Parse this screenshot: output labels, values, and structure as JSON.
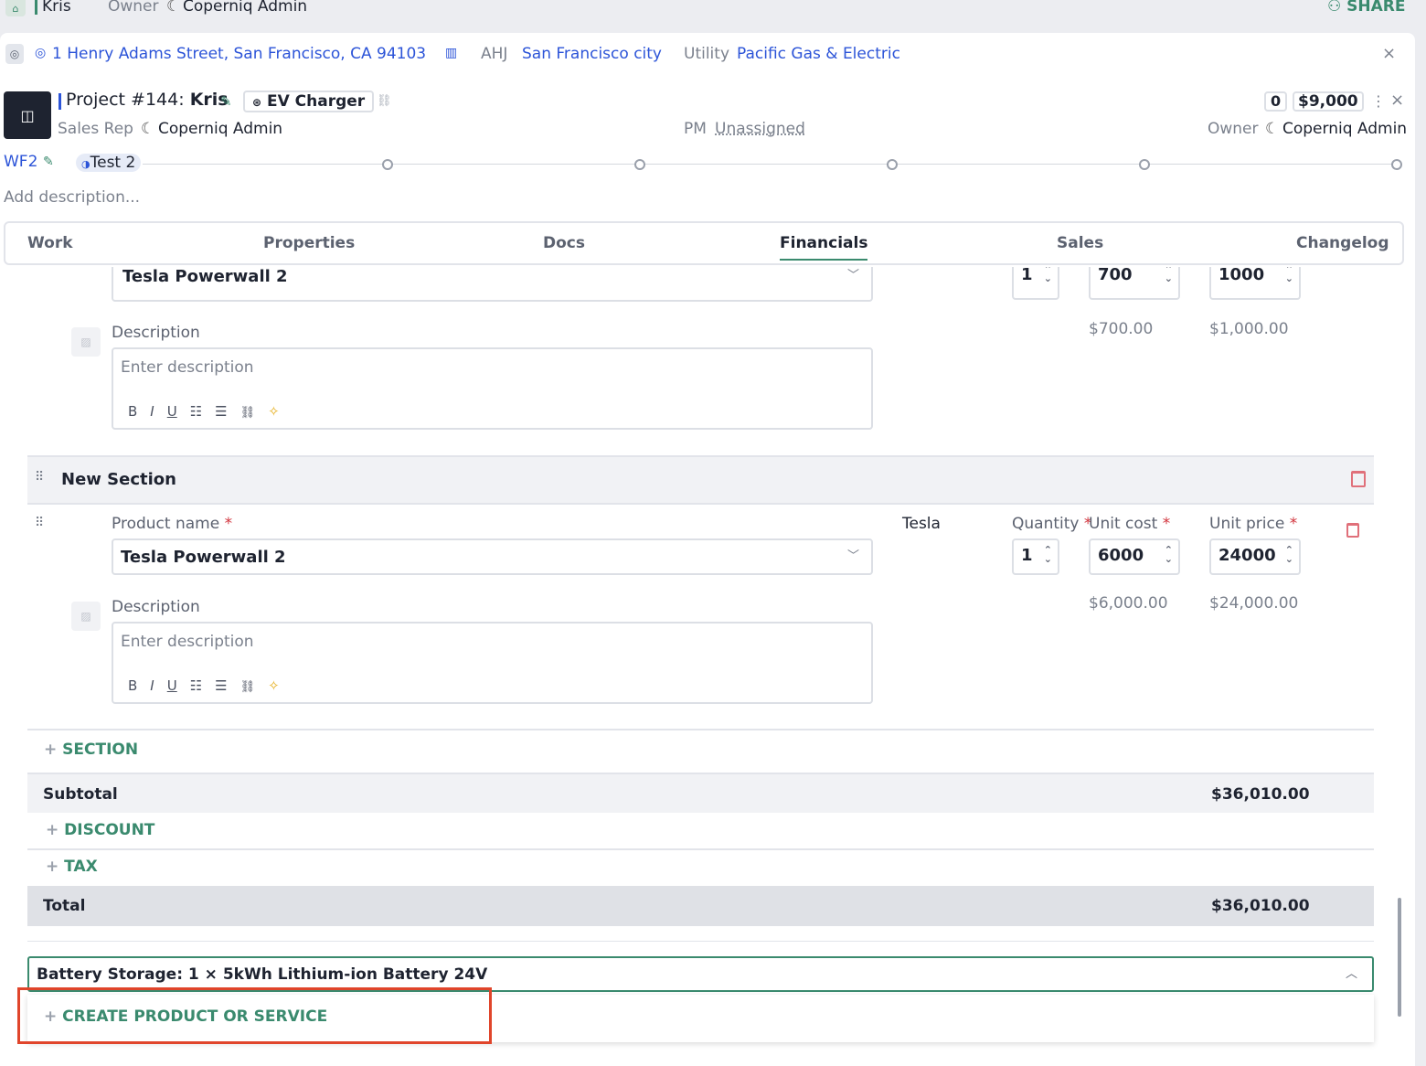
{
  "topbar": {
    "project_name": "Kris",
    "owner_label": "Owner",
    "owner_name": "Coperniq Admin",
    "share_label": "SHARE"
  },
  "address_bar": {
    "address": "1 Henry Adams Street, San Francisco, CA 94103",
    "ahj_label": "AHJ",
    "ahj_value": "San Francisco city",
    "utility_label": "Utility",
    "utility_value": "Pacific Gas & Electric"
  },
  "project": {
    "title_prefix": "Project #144:",
    "title_name": "Kris",
    "tag": "EV Charger",
    "count": "0",
    "amount": "$9,000",
    "sales_rep_label": "Sales Rep",
    "sales_rep": "Coperniq Admin",
    "pm_label": "PM",
    "pm_value": "Unassigned",
    "owner_label": "Owner",
    "owner": "Coperniq Admin",
    "workflow": "WF2",
    "stage": "Test 2",
    "description_placeholder": "Add description..."
  },
  "tabs": [
    {
      "label": "Work"
    },
    {
      "label": "Properties"
    },
    {
      "label": "Docs"
    },
    {
      "label": "Financials"
    },
    {
      "label": "Sales"
    },
    {
      "label": "Changelog"
    }
  ],
  "item1": {
    "product": "Tesla Powerwall 2",
    "qty": "1",
    "unit_cost": "700",
    "unit_price": "1000",
    "cost_total": "$700.00",
    "price_total": "$1,000.00",
    "desc_label": "Description",
    "desc_placeholder": "Enter description"
  },
  "section": {
    "title": "New Section"
  },
  "item2": {
    "product_label": "Product name",
    "product": "Tesla Powerwall 2",
    "manufacturer": "Tesla",
    "qty_label": "Quantity",
    "qty": "1",
    "unit_cost_label": "Unit cost",
    "unit_cost": "6000",
    "unit_price_label": "Unit price",
    "unit_price": "24000",
    "cost_total": "$6,000.00",
    "price_total": "$24,000.00",
    "desc_label": "Description",
    "desc_placeholder": "Enter description"
  },
  "rte": {
    "bold": "B",
    "italic": "I",
    "underline": "U",
    "ol": "☷",
    "ul": "☰",
    "link": "🔗",
    "magic": "✨"
  },
  "totals": {
    "add_section": "SECTION",
    "subtotal_label": "Subtotal",
    "subtotal": "$36,010.00",
    "discount": "DISCOUNT",
    "tax": "TAX",
    "total_label": "Total",
    "total": "$36,010.00"
  },
  "search": {
    "value": "Battery Storage: 1 × 5kWh Lithium-ion Battery 24V",
    "create_label": "CREATE PRODUCT OR SERVICE"
  },
  "colors": {
    "accent": "#3a8a6e",
    "link": "#2c54d8",
    "highlight": "#e0452b"
  }
}
